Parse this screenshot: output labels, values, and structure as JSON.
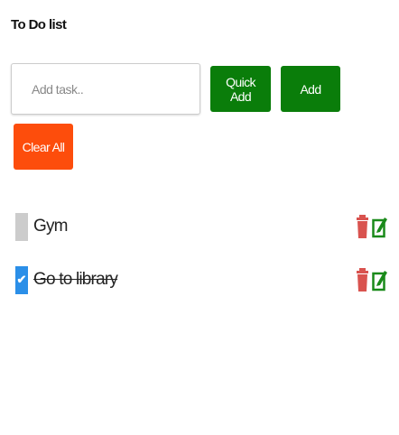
{
  "title": "To Do list",
  "input": {
    "placeholder": "Add task..",
    "value": ""
  },
  "buttons": {
    "quick_add": "Quick Add",
    "add": "Add",
    "clear_all": "Clear All"
  },
  "colors": {
    "green": "#0a7d0a",
    "orange": "#fd4d0c",
    "checkbox_checked": "#2b8fe8",
    "trash": "#d9534f"
  },
  "tasks": [
    {
      "label": "Gym",
      "done": false,
      "icons": [
        "trash-icon",
        "edit-icon"
      ]
    },
    {
      "label": "Go to library",
      "done": true,
      "icons": [
        "trash-icon",
        "edit-icon"
      ]
    }
  ]
}
